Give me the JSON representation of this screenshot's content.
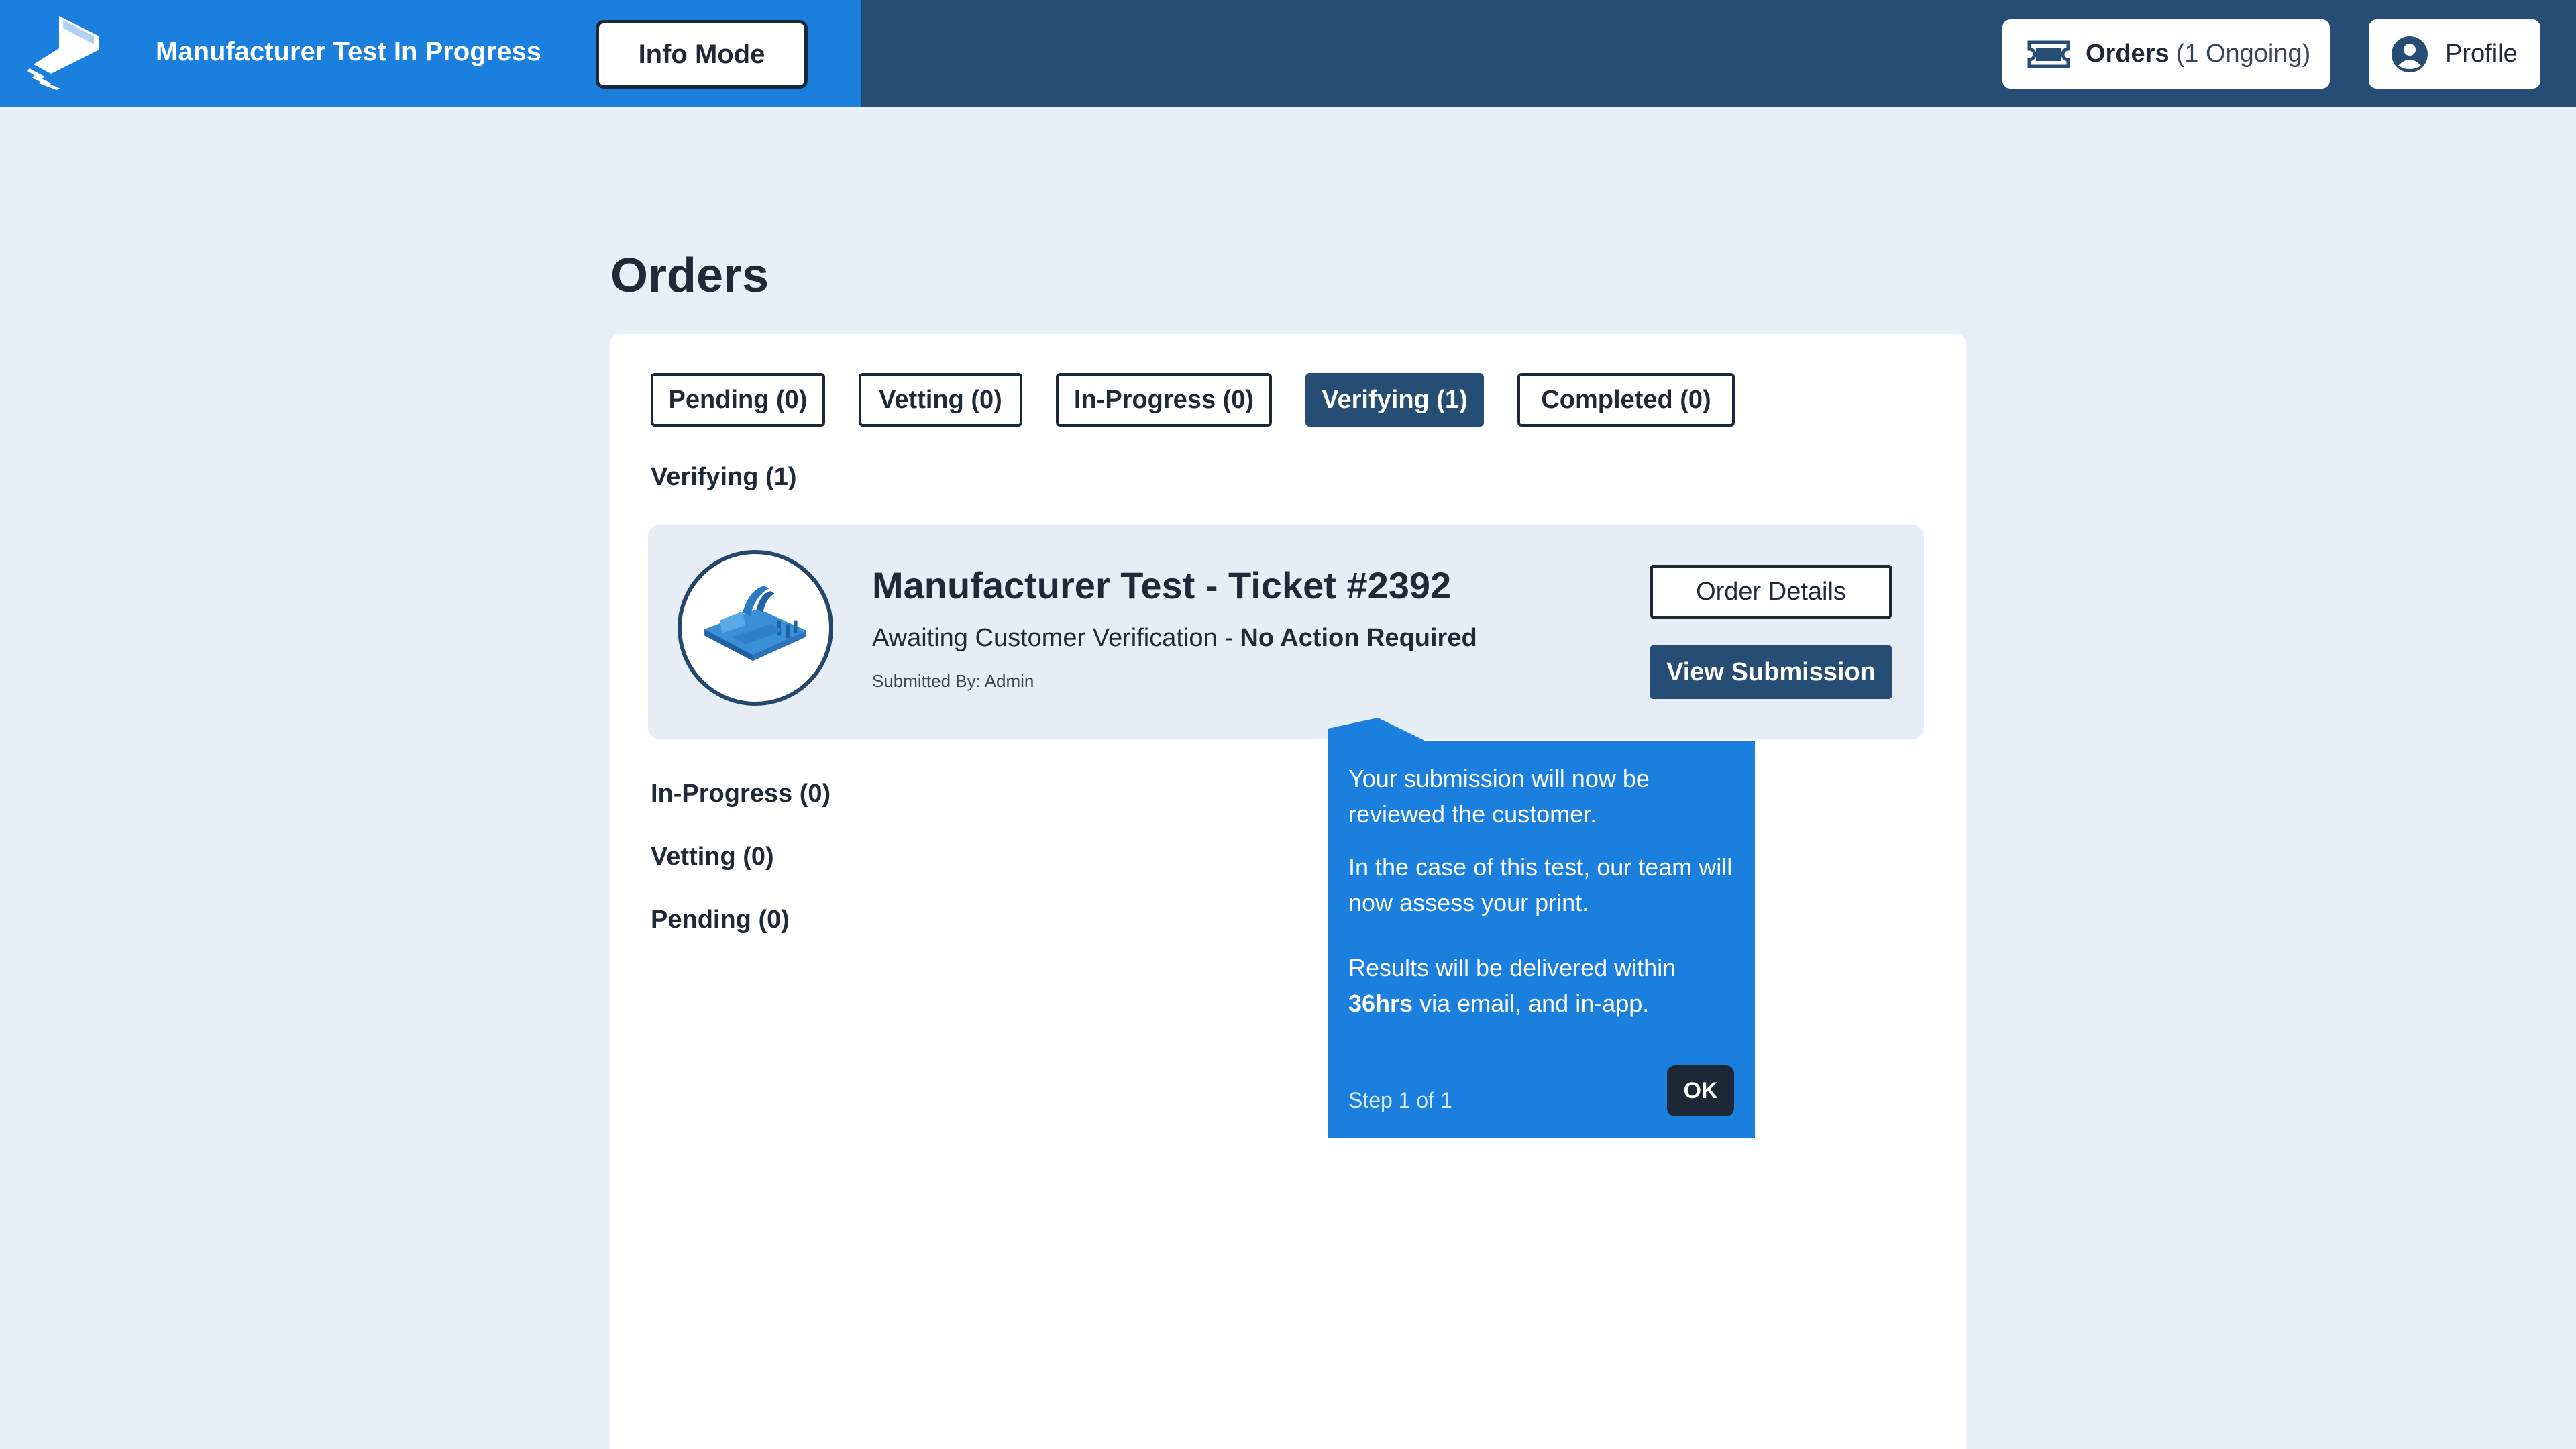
{
  "header": {
    "title": "Manufacturer Test In Progress",
    "info_mode_label": "Info Mode",
    "orders_label": "Orders",
    "orders_count_text": "(1 Ongoing)",
    "profile_label": "Profile",
    "colors": {
      "bar": "#264d73",
      "brand": "#1b7fde"
    }
  },
  "page": {
    "title": "Orders"
  },
  "tabs": [
    {
      "label": "Pending (0)",
      "active": false
    },
    {
      "label": "Vetting (0)",
      "active": false
    },
    {
      "label": "In-Progress (0)",
      "active": false
    },
    {
      "label": "Verifying (1)",
      "active": true
    },
    {
      "label": "Completed (0)",
      "active": false
    }
  ],
  "sections": {
    "verifying": "Verifying (1)",
    "in_progress": "In-Progress (0)",
    "vetting": "Vetting (0)",
    "pending": "Pending (0)"
  },
  "order": {
    "title": "Manufacturer Test - Ticket #2392",
    "status_prefix": "Awaiting Customer Verification - ",
    "status_bold": "No Action Required",
    "submitted_by": "Submitted By: Admin",
    "order_details_label": "Order Details",
    "view_submission_label": "View Submission"
  },
  "tooltip": {
    "para1": "Your submission will now be reviewed the customer.",
    "para2": "In the case of this test, our team will now assess your print.",
    "para3_prefix": "Results will be delivered within ",
    "para3_bold": "36hrs",
    "para3_suffix": " via email, and in-app.",
    "step": "Step 1 of 1",
    "ok_label": "OK"
  },
  "icons": {
    "logo": "brand-logo-icon",
    "orders": "ticket-icon",
    "profile": "user-circle-icon"
  }
}
